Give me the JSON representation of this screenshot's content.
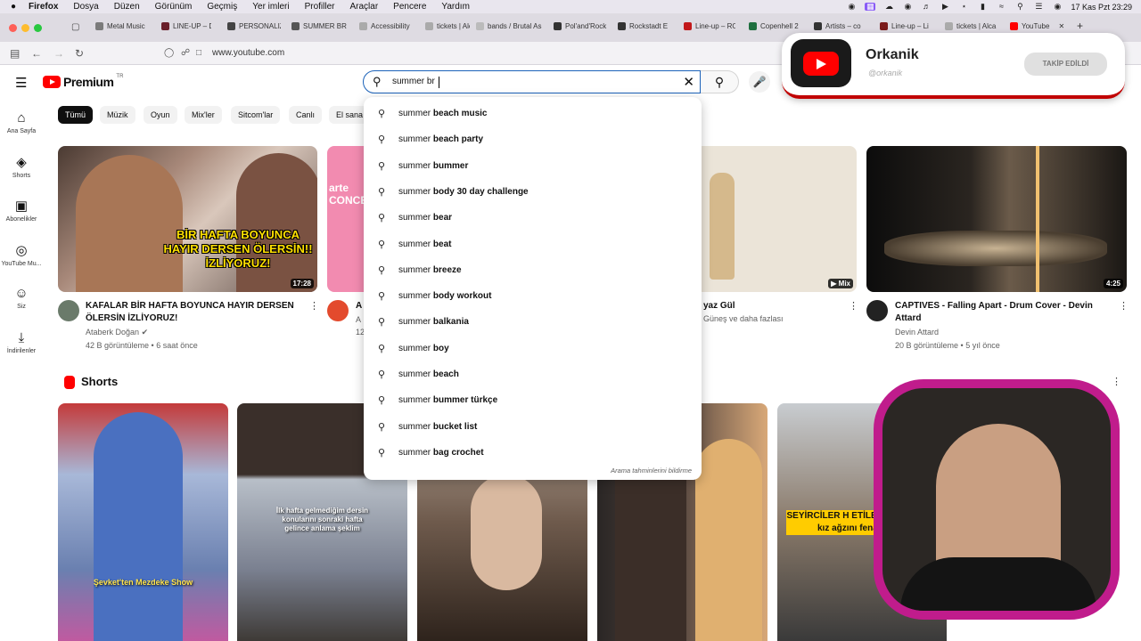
{
  "menubar": {
    "app": "Firefox",
    "items": [
      "Dosya",
      "Düzen",
      "Görünüm",
      "Geçmiş",
      "Yer imleri",
      "Profiller",
      "Araçlar",
      "Pencere",
      "Yardım"
    ],
    "clock": "17 Kas Pzt  23:29"
  },
  "tabs": [
    {
      "label": "Metal Music"
    },
    {
      "label": "LINE-UP – D"
    },
    {
      "label": "PERSONALIZ"
    },
    {
      "label": "SUMMER BR"
    },
    {
      "label": "Accessibility"
    },
    {
      "label": "tickets | Alca"
    },
    {
      "label": "bands / Brutal As"
    },
    {
      "label": "Pol'and'Rock"
    },
    {
      "label": "Rockstadt E"
    },
    {
      "label": "Line-up – RO"
    },
    {
      "label": "Copenhell 2"
    },
    {
      "label": "Artists – co"
    },
    {
      "label": "Line-up – Li"
    },
    {
      "label": "tickets | Alca"
    },
    {
      "label": "YouTube"
    }
  ],
  "url": "www.youtube.com",
  "header": {
    "logo_text": "Premium",
    "logo_region": "TR"
  },
  "search": {
    "value": "summer br",
    "footer": "Arama tahminlerini bildirme",
    "suggestions": [
      "summer beach music",
      "summer beach party",
      "summer bummer",
      "summer body 30 day challenge",
      "summer bear",
      "summer beat",
      "summer breeze",
      "summer body workout",
      "summer balkania",
      "summer boy",
      "summer beach",
      "summer bummer türkçe",
      "summer bucket list",
      "summer bag crochet"
    ]
  },
  "rail": [
    {
      "label": "Ana Sayfa",
      "icon": "home-icon"
    },
    {
      "label": "Shorts",
      "icon": "shorts-icon"
    },
    {
      "label": "Abonelikler",
      "icon": "subscriptions-icon"
    },
    {
      "label": "YouTube Mu...",
      "icon": "music-icon"
    },
    {
      "label": "Siz",
      "icon": "user-icon"
    },
    {
      "label": "İndirilenler",
      "icon": "download-icon"
    }
  ],
  "chips": [
    "Tümü",
    "Müzik",
    "Oyun",
    "Mix'ler",
    "Sitcom'lar",
    "Canlı",
    "El sana"
  ],
  "videos": [
    {
      "title": "KAFALAR BİR HAFTA BOYUNCA HAYIR DERSEN ÖLERSİN İZLİYORUZ!",
      "channel": "Ataberk Doğan",
      "meta": "42 B görüntüleme • 6 saat önce",
      "duration": "17:28",
      "thumb_caption": "BİR HAFTA BOYUNCA HAYIR DERSEN ÖLERSİN!! İZLİYORUZ!"
    },
    {
      "title": "A",
      "channel": "A",
      "meta": "12",
      "thumb_caption": "arte CONCERT"
    },
    {
      "title": "yaz Gül",
      "channel": "Güneş ve daha fazlası",
      "duration": "Mix"
    },
    {
      "title": "CAPTIVES  - Falling Apart - Drum Cover - Devin Attard",
      "channel": "Devin Attard",
      "meta": "20 B görüntüleme • 5 yıl önce",
      "duration": "4:25"
    }
  ],
  "shorts": {
    "heading": "Shorts",
    "items": [
      {
        "caption": "Şevket'ten Mezdeke Show"
      },
      {
        "caption": "İlk hafta gelmediğim dersin konularını sonraki hafta gelince anlama şeklim"
      },
      {
        "caption": ""
      },
      {
        "caption": ""
      },
      {
        "caption": "SEYİRCİLER H ETİLER 18  Seyirciye kız ağzını fena bozdu"
      }
    ]
  },
  "channel_card": {
    "name": "Orkanik",
    "handle": "@orkanik",
    "button": "TAKİP EDİLDİ"
  },
  "colors": {
    "accent": "#ff0000",
    "search_border": "#1c62b9",
    "webcam_frame": "#c01c8c"
  }
}
